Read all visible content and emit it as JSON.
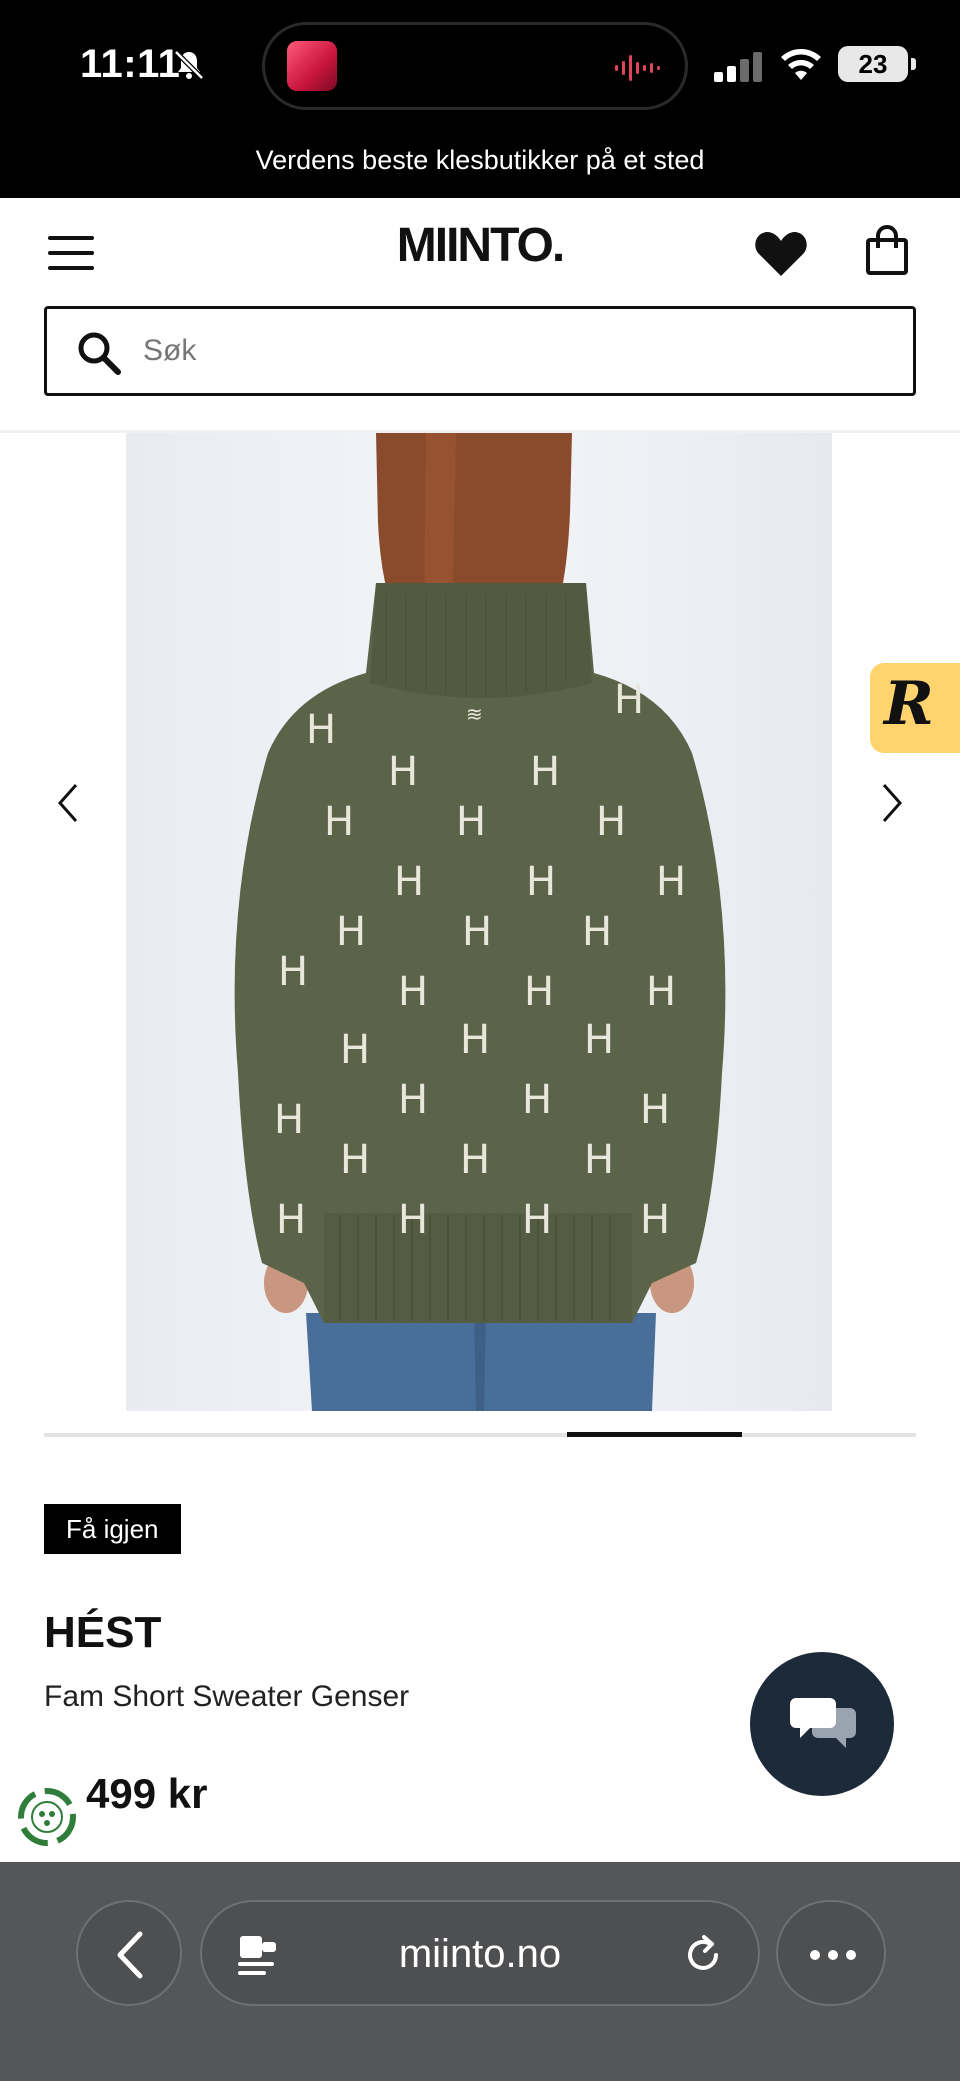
{
  "status_bar": {
    "time": "11:11",
    "battery": "23",
    "icons": [
      "bell-slash-icon",
      "signal-icon",
      "wifi-icon",
      "battery-icon"
    ],
    "now_playing_icon": "waveform-icon"
  },
  "promo": {
    "tagline": "Verdens beste klesbutikker på et sted"
  },
  "header": {
    "logo": "MIINTO.",
    "icons": [
      "hamburger-menu-icon",
      "heart-icon",
      "shopping-bag-icon"
    ]
  },
  "search": {
    "placeholder": "Søk",
    "value": ""
  },
  "gallery": {
    "current_slide_fraction": {
      "start": 0.6,
      "end": 0.8
    },
    "nav_icons": [
      "chevron-left-icon",
      "chevron-right-icon"
    ],
    "side_badge_letter": "R"
  },
  "product": {
    "badge": "Få igjen",
    "brand": "HÉST",
    "name": "Fam Short Sweater Genser",
    "price": "499 kr"
  },
  "colors": {
    "sweater": "#5b6349",
    "badge_bg": "#000000",
    "chat_button": "#1d2a3a",
    "r_badge": "#ffd36e",
    "browser_bar": "#555658"
  },
  "browser": {
    "url": "miinto.no",
    "icons": [
      "back-icon",
      "reader-icon",
      "reload-icon",
      "more-icon"
    ]
  }
}
